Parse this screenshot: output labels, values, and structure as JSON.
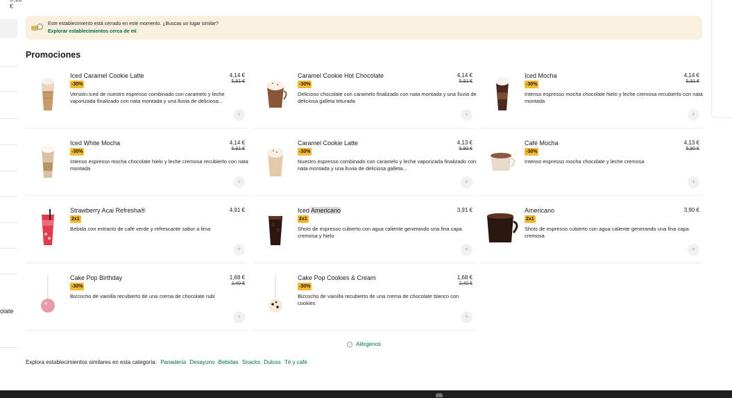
{
  "window": {
    "top_cut_text": "0,15 €"
  },
  "sidebar": {
    "cut_label": "olate"
  },
  "notice": {
    "message": "Este establecimiento está cerrado en este momento. ¿Buscas un lugar similar?",
    "link": "Explorar establecimientos cerca de mí"
  },
  "section": {
    "title": "Promociones"
  },
  "products": [
    {
      "name": "Iced Caramel Cookie Latte",
      "badge": "-30%",
      "price": "4,14 €",
      "old_price": "5,91 €",
      "description": "Versión iced de nuestro espresso combinado con caramelo y leche vaporizada finalizado con nata montada y una lluvia de deliciosa...",
      "drink": "iced-latte"
    },
    {
      "name": "Caramel Cookie Hot Chocolate",
      "badge": "-30%",
      "price": "4,14 €",
      "old_price": "5,91 €",
      "description": "Delicioso chocolate con caramelo finalizado con nata montada y una lluvia de deliciosa galleta triturada",
      "drink": "hot-choc-cream"
    },
    {
      "name": "Iced Mocha",
      "badge": "-30%",
      "price": "4,14 €",
      "old_price": "5,91 €",
      "description": "Intenso espresso mocha chocolate hielo y leche cremosa recubierto con nata montada",
      "drink": "iced-mocha"
    },
    {
      "name": "Iced White Mocha",
      "badge": "-30%",
      "price": "4,14 €",
      "old_price": "5,91 €",
      "description": "Intenso espresso mocha chocolate hielo y leche cremosa recubierto con nata montada",
      "drink": "iced-white-mocha"
    },
    {
      "name": "Caramel Cookie Latte",
      "badge": "-30%",
      "price": "4,13 €",
      "old_price": "5,90 €",
      "description": "Nuestro espresso combinado con caramelo y leche vaporizada finalizado con nata montada y una lluvia de deliciosa galleta...",
      "drink": "latte-cream"
    },
    {
      "name": "Café Mocha",
      "badge": "-30%",
      "price": "4,13 €",
      "old_price": "5,90 €",
      "description": "Intenso espresso mocha chocolate y leche cremosa",
      "drink": "mocha-cup"
    },
    {
      "name": "Strawberry Acai Refresha®",
      "badge": "2x1",
      "price": "4,91 €",
      "old_price": "",
      "description": "Bebida con extracto de café verde y refrescante sabor a lima",
      "drink": "refresha"
    },
    {
      "name_prefix": "Iced ",
      "name_highlight": "Americano",
      "badge": "2x1",
      "price": "3,91 €",
      "old_price": "",
      "description": "Shots de espresso cubierto con agua caliente generando una fina capa cremosa y hielo",
      "drink": "iced-americano"
    },
    {
      "name": "Americano",
      "badge": "2x1",
      "price": "3,90 €",
      "old_price": "",
      "description": "Shots de espresso cubierto con agua caliente generando una fina capa cremosa",
      "drink": "americano-mug"
    },
    {
      "name": "Cake Pop Birthday",
      "badge": "-30%",
      "price": "1,68 €",
      "old_price": "2,40 €",
      "description": "Bizcocho de vainilla recubierto de una crema de chocolate rubí",
      "drink": "cakepop-pink"
    },
    {
      "name": "Cake Pop Cookies & Cream",
      "badge": "-30%",
      "price": "1,68 €",
      "old_price": "2,40 €",
      "description": "Bizcocho de vainilla recubierto de una crema de chocolate blanco con cookies",
      "drink": "cakepop-cookie"
    }
  ],
  "allergens": {
    "label": "Alérgenos"
  },
  "explore": {
    "prefix": "Explora establecimientos similares en esta categoría:",
    "categories": [
      "Panadería",
      "Desayuno",
      "Bebidas",
      "Snacks",
      "Dulces",
      "Té y café"
    ]
  },
  "colors": {
    "accent": "#00704a",
    "badge": "#f5b82e",
    "notice_bg": "#f9efdf"
  }
}
